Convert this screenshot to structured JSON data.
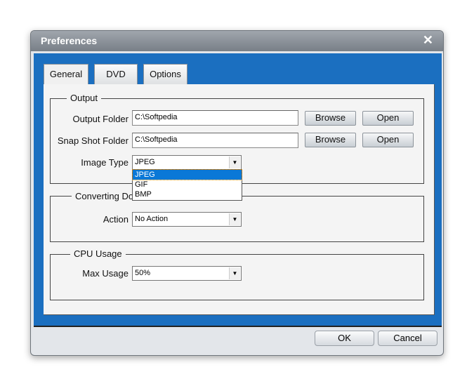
{
  "window": {
    "title": "Preferences",
    "close_icon": "close-icon"
  },
  "tabs": [
    {
      "label": "General",
      "active": true
    },
    {
      "label": "DVD"
    },
    {
      "label": "Options"
    }
  ],
  "output": {
    "legend": "Output",
    "output_folder": {
      "label": "Output Folder",
      "value": "C:\\Softpedia"
    },
    "snapshot_folder": {
      "label": "Snap Shot Folder",
      "value": "C:\\Softpedia"
    },
    "browse_label": "Browse",
    "open_label": "Open",
    "image_type": {
      "label": "Image Type",
      "value": "JPEG",
      "options": [
        "JPEG",
        "GIF",
        "BMP"
      ]
    }
  },
  "converting": {
    "legend": "Converting Do",
    "action": {
      "label": "Action",
      "value": "No Action"
    }
  },
  "cpu": {
    "legend": "CPU Usage",
    "max_usage": {
      "label": "Max Usage",
      "value": "50%"
    }
  },
  "footer": {
    "ok": "OK",
    "cancel": "Cancel"
  },
  "colors": {
    "accent": "#1b6fc0",
    "highlight": "#0a78d7"
  }
}
